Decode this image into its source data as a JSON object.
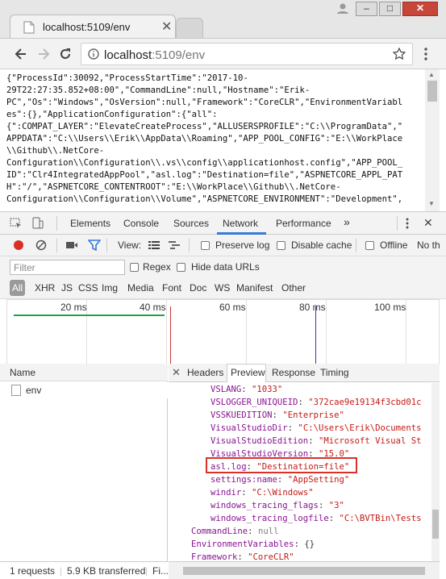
{
  "window": {
    "tab_title": "localhost:5109/env",
    "minimize_glyph": "–",
    "maximize_glyph": "□",
    "close_glyph": "✕"
  },
  "addressbar": {
    "url_host": "localhost",
    "url_rest": ":5109/env",
    "back_icon": "back-arrow-icon",
    "forward_icon": "forward-arrow-icon",
    "reload_icon": "reload-icon",
    "bookmark_icon": "star-icon",
    "menu_icon": "kebab-menu-icon"
  },
  "page": {
    "lines": [
      "{\"ProcessId\":30092,\"ProcessStartTime\":\"2017-10-",
      "29T22:27:35.852+08:00\",\"CommandLine\":null,\"Hostname\":\"Erik-",
      "PC\",\"Os\":\"Windows\",\"OsVersion\":null,\"Framework\":\"CoreCLR\",\"EnvironmentVariabl",
      "es\":{},\"ApplicationConfiguration\":{\"all\":",
      "{\":COMPAT_LAYER\":\"ElevateCreateProcess\",\"ALLUSERSPROFILE\":\"C:\\\\ProgramData\",\"",
      "APPDATA\":\"C:\\\\Users\\\\Erik\\\\AppData\\\\Roaming\",\"APP_POOL_CONFIG\":\"E:\\\\WorkPlace",
      "\\\\Github\\\\.NetCore-",
      "Configuration\\\\Configuration\\\\.vs\\\\config\\\\applicationhost.config\",\"APP_POOL_",
      "ID\":\"Clr4IntegratedAppPool\",\"asl.log\":\"Destination=file\",\"ASPNETCORE_APPL_PAT",
      "H\":\"/\",\"ASPNETCORE_CONTENTROOT\":\"E:\\\\WorkPlace\\\\Github\\\\.NetCore-",
      "Configuration\\\\Configuration\\\\Volume\",\"ASPNETCORE_ENVIRONMENT\":\"Development\","
    ]
  },
  "devtools": {
    "tabs": [
      "Elements",
      "Console",
      "Sources",
      "Network",
      "Performance"
    ],
    "more_tabs_glyph": "»",
    "active_tab": "Network",
    "toolbar": {
      "view_label": "View:",
      "preserve_log": "Preserve log",
      "disable_cache": "Disable cache",
      "offline": "Offline",
      "throttle": "No th"
    },
    "filter": {
      "placeholder": "Filter",
      "regex": "Regex",
      "hide_data_urls": "Hide data URLs"
    },
    "types": [
      "All",
      "XHR",
      "JS",
      "CSS",
      "Img",
      "Media",
      "Font",
      "Doc",
      "WS",
      "Manifest",
      "Other"
    ],
    "overview_ticks": [
      "20 ms",
      "40 ms",
      "60 ms",
      "80 ms",
      "100 ms"
    ],
    "name_header": "Name",
    "requests": [
      {
        "name": "env"
      }
    ],
    "detail_tabs": [
      "Headers",
      "Preview",
      "Response",
      "Timing"
    ],
    "detail_close_glyph": "✕",
    "active_detail_tab": "Preview",
    "preview_rows": [
      {
        "key": "VSLANG",
        "value": "\"1033\"",
        "indent": 1,
        "kind": "string"
      },
      {
        "key": "VSLOGGER_UNIQUEID",
        "value": "\"372cae9e19134f3cbd01c",
        "indent": 1,
        "kind": "string"
      },
      {
        "key": "VSSKUEDITION",
        "value": "\"Enterprise\"",
        "indent": 1,
        "kind": "string"
      },
      {
        "key": "VisualStudioDir",
        "value": "\"C:\\Users\\Erik\\Documents",
        "indent": 1,
        "kind": "string"
      },
      {
        "key": "VisualStudioEdition",
        "value": "\"Microsoft Visual St",
        "indent": 1,
        "kind": "string"
      },
      {
        "key": "VisualStudioVersion",
        "value": "\"15.0\"",
        "indent": 1,
        "kind": "string"
      },
      {
        "key": "asl.log",
        "value": "\"Destination=file\"",
        "indent": 1,
        "kind": "string"
      },
      {
        "key": "settings:name",
        "value": "\"AppSetting\"",
        "indent": 1,
        "kind": "string"
      },
      {
        "key": "windir",
        "value": "\"C:\\Windows\"",
        "indent": 1,
        "kind": "string"
      },
      {
        "key": "windows_tracing_flags",
        "value": "\"3\"",
        "indent": 1,
        "kind": "string"
      },
      {
        "key": "windows_tracing_logfile",
        "value": "\"C:\\BVTBin\\Tests",
        "indent": 1,
        "kind": "string"
      },
      {
        "key": "CommandLine",
        "value": "null",
        "indent": 0,
        "kind": "null"
      },
      {
        "key": "EnvironmentVariables",
        "value": "{}",
        "indent": 0,
        "kind": "object"
      },
      {
        "key": "Framework",
        "value": "\"CoreCLR\"",
        "indent": 0,
        "kind": "string"
      }
    ],
    "status": {
      "requests": "1 requests",
      "transferred": "5.9 KB transferred",
      "finish": "Fi..."
    }
  },
  "colors": {
    "accent": "#3879d9",
    "highlight_box": "#d8312a",
    "json_key": "#881391",
    "json_string": "#c41a16",
    "record": "#d93025",
    "filter_icon": "#3879d9"
  }
}
